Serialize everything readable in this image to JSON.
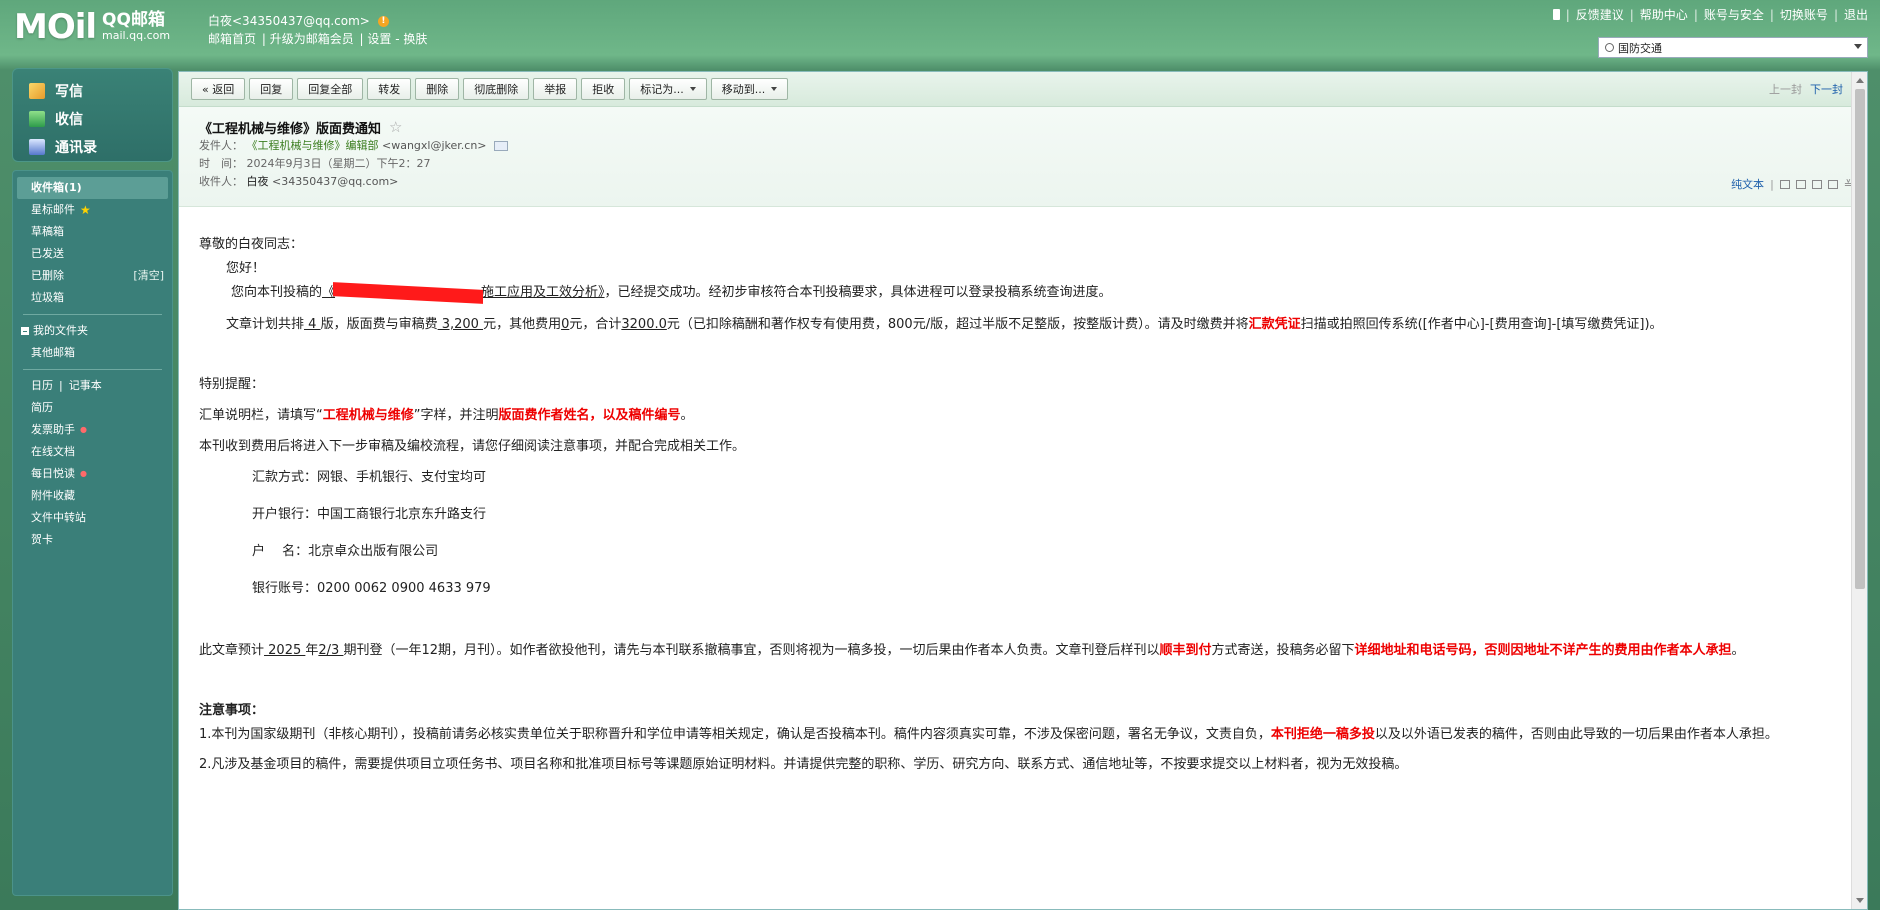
{
  "header": {
    "logo_mark": "MOil",
    "logo_title": "QQ邮箱",
    "logo_sub": "mail.qq.com",
    "user": "白夜<34350437@qq.com>",
    "warn": "!",
    "links": [
      "邮箱首页",
      "升级为邮箱会员",
      "设置 - 换肤"
    ],
    "top_links": [
      "反馈建议",
      "帮助中心",
      "账号与安全",
      "切换账号",
      "退出"
    ],
    "search_value": "国防交通"
  },
  "sidebar": {
    "quick": [
      "写信",
      "收信",
      "通讯录"
    ],
    "folders": {
      "inbox": "收件箱(1)",
      "starred": "星标邮件",
      "drafts": "草稿箱",
      "sent": "已发送",
      "deleted": "已删除",
      "clear": "[清空]",
      "spam": "垃圾箱",
      "my_folders": "我的文件夹",
      "other": "其他邮箱",
      "calendar": "日历",
      "notes": "记事本",
      "memo": "简历",
      "invoice": "发票助手",
      "docs": "在线文档",
      "daily": "每日悦读",
      "attachments": "附件收藏",
      "transfer": "文件中转站",
      "cards": "贺卡"
    }
  },
  "toolbar": {
    "back": "« 返回",
    "reply": "回复",
    "reply_all": "回复全部",
    "forward": "转发",
    "delete": "删除",
    "delete_perm": "彻底删除",
    "report": "举报",
    "reject": "拒收",
    "mark": "标记为...",
    "move": "移动到...",
    "prev": "上一封",
    "next": "下一封"
  },
  "mail": {
    "subject": "《工程机械与维修》版面费通知",
    "from_label": "发件人：",
    "from_name": "《工程机械与维修》编辑部",
    "from_addr": "<wangxl@jker.cn>",
    "time_label": "时　间：",
    "time": "2024年9月3日（星期二）下午2：27",
    "to_label": "收件人：",
    "to_name": "白夜",
    "to_addr": "<34350437@qq.com>",
    "plain_text": "纯文本"
  },
  "body": {
    "greeting": "尊敬的白夜同志：",
    "hello": "您好！",
    "p1_a": "您向本刊投稿的",
    "p1_title_a": "《",
    "p1_title_b": "施工应用及工效分析》",
    "p1_b": "，已经提交成功。经初步审核符合本刊投稿要求，具体进程可以登录投稿系统查询进度。",
    "p2_a": "文章计划共排",
    "p2_pages": " 4 ",
    "p2_b": "版，版面费与审稿费",
    "p2_fee": " 3,200 ",
    "p2_c": "元，其他费用",
    "p2_other": "0",
    "p2_d": "元，合计",
    "p2_total": "3200.0",
    "p2_e": "元（已扣除稿酬和著作权专有使用费，800元/版，超过半版不足整版，按整版计费）。请及时缴费并将",
    "p2_red": "汇款凭证",
    "p2_f": "扫描或拍照回传系统([作者中心]-[费用查询]-[填写缴费凭证])。",
    "remind_title": "特别提醒：",
    "remind_a": "汇单说明栏，请填写“",
    "remind_red1": "工程机械与维修",
    "remind_b": "”字样，并注明",
    "remind_red2": "版面费作者姓名，以及稿件编号",
    "remind_c": "。",
    "process": "本刊收到费用后将进入下一步审稿及编校流程，请您仔细阅读注意事项，并配合完成相关工作。",
    "pay_method": "汇款方式：网银、手机银行、支付宝均可",
    "bank": "开户银行：中国工商银行北京东升路支行",
    "account_name": "户　 名：北京卓众出版有限公司",
    "account_no": "银行账号：0200 0062 0900 4633 979",
    "pub_a": "此文章预计",
    "pub_year": " 2025 ",
    "pub_b": "年",
    "pub_issue": "2/3 ",
    "pub_c": "期刊登（一年12期，月刊）。如作者欲投他刊，请先与本刊联系撤稿事宜，否则将视为一稿多投，一切后果由作者本人负责。文章刊登后样刊以",
    "pub_red1": "顺丰到付",
    "pub_d": "方式寄送，投稿务必留下",
    "pub_red2": "详细地址和电话号码，否则因地址不详产生的费用由作者本人承担",
    "pub_e": "。",
    "notice_title": "注意事项：",
    "n1_a": "1.本刊为国家级期刊（非核心期刊），投稿前请务必核实贵单位关于职称晋升和学位申请等相关规定，确认是否投稿本刊。稿件内容须真实可靠，不涉及保密问题，署名无争议，文责自负，",
    "n1_red": "本刊拒绝一稿多投",
    "n1_b": "以及以外语已发表的稿件，否则由此导致的一切后果由作者本人承担。",
    "n2": "2.凡涉及基金项目的稿件，需要提供项目立项任务书、项目名称和批准项目标号等课题原始证明材料。并请提供完整的职称、学历、研究方向、联系方式、通信地址等，不按要求提交以上材料者，视为无效投稿。"
  }
}
